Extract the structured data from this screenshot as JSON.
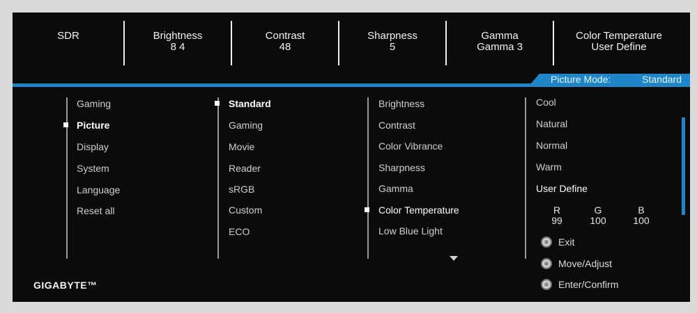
{
  "topbar": {
    "sdr": "SDR",
    "brightness": {
      "label": "Brightness",
      "value": "8 4"
    },
    "contrast": {
      "label": "Contrast",
      "value": "48"
    },
    "sharpness": {
      "label": "Sharpness",
      "value": "5"
    },
    "gamma": {
      "label": "Gamma",
      "value": "Gamma 3"
    },
    "color_temperature": {
      "label": "Color Temperature",
      "value": "User Define"
    }
  },
  "picture_mode": {
    "label": "Picture Mode:",
    "value": "Standard"
  },
  "main_menu": [
    "Gaming",
    "Picture",
    "Display",
    "System",
    "Language",
    "Reset all"
  ],
  "picture_modes": [
    "Standard",
    "Gaming",
    "Movie",
    "Reader",
    "sRGB",
    "Custom",
    "ECO"
  ],
  "picture_settings": [
    "Brightness",
    "Contrast",
    "Color Vibrance",
    "Sharpness",
    "Gamma",
    "Color Temperature",
    "Low Blue Light"
  ],
  "color_temp_options": [
    "Cool",
    "Natural",
    "Normal",
    "Warm",
    "User Define"
  ],
  "rgb": {
    "r_label": "R",
    "g_label": "G",
    "b_label": "B",
    "r_value": "99",
    "g_value": "100",
    "b_value": "100"
  },
  "hints": {
    "exit": "Exit",
    "move": "Move/Adjust",
    "enter": "Enter/Confirm"
  },
  "brand": "GIGABYTE™",
  "colors": {
    "accent": "#1f86c9",
    "background": "#0b0b0c"
  }
}
